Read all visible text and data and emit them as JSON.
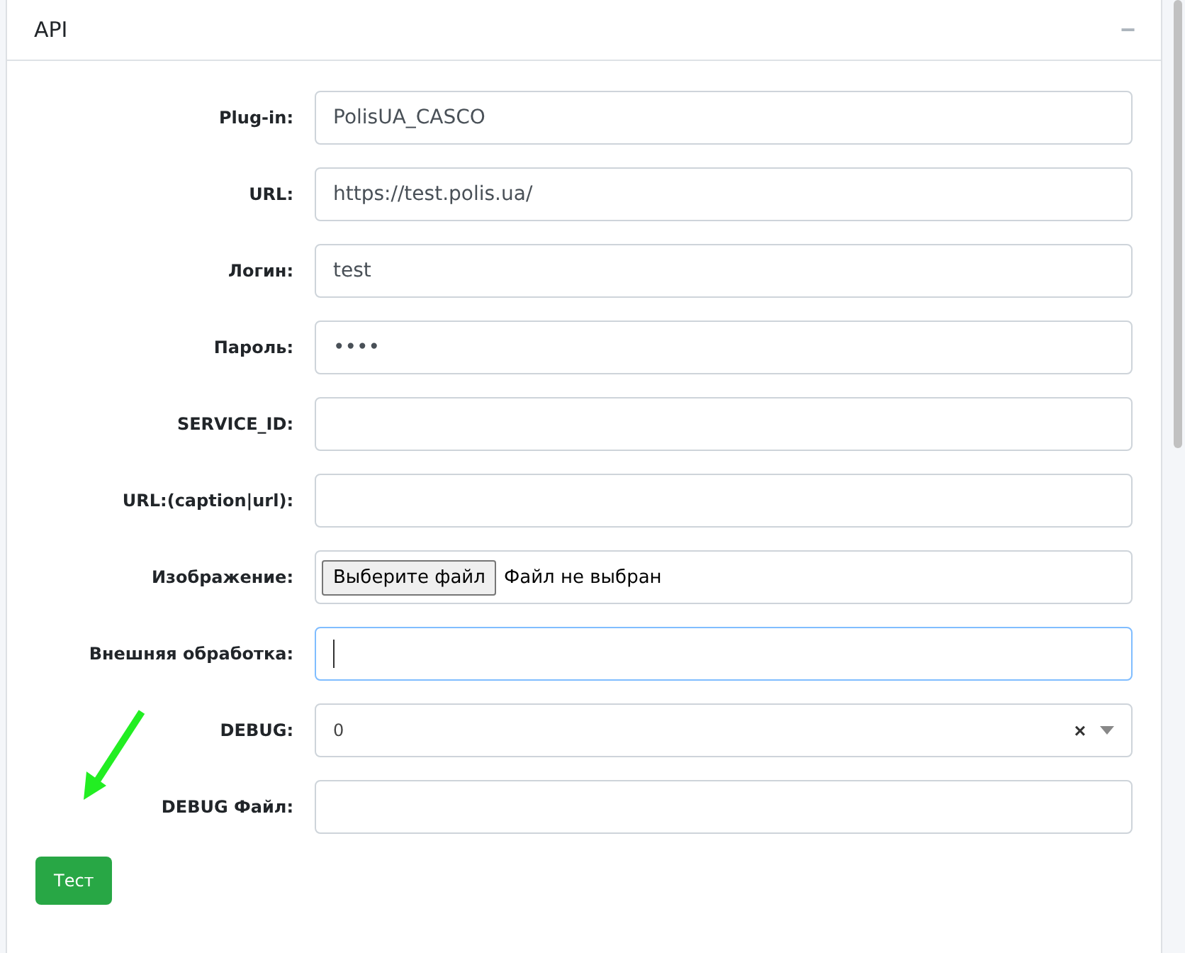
{
  "card": {
    "title": "API",
    "collapse_icon": "−"
  },
  "fields": [
    {
      "label": "Plug-in:",
      "kind": "text",
      "value": "PolisUA_CASCO",
      "focused": false
    },
    {
      "label": "URL:",
      "kind": "text",
      "value": "https://test.polis.ua/",
      "focused": false
    },
    {
      "label": "Логин:",
      "kind": "text",
      "value": "test",
      "focused": false
    },
    {
      "label": "Пароль:",
      "kind": "password",
      "value": "••••",
      "focused": false
    },
    {
      "label": "SERVICE_ID:",
      "kind": "text",
      "focused": false
    },
    {
      "label": "URL:(caption|url):",
      "kind": "text",
      "focused": false
    },
    {
      "label": "Изображение:",
      "kind": "file",
      "button": "Выберите файл",
      "status": "Файл не выбран",
      "focused": false
    },
    {
      "label": "Внешняя обработка:",
      "kind": "text",
      "focused": true
    },
    {
      "label": "DEBUG:",
      "kind": "select",
      "value": "0",
      "clear": "×",
      "focused": false
    },
    {
      "label": "DEBUG Файл:",
      "kind": "text",
      "focused": false
    }
  ],
  "test_button": "Тест"
}
